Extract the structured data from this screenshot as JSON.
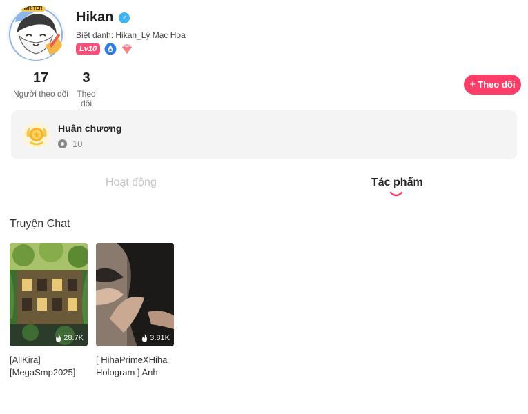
{
  "profile": {
    "avatar_badge": "WRITER",
    "username": "Hikan",
    "gender_icon": "male-icon",
    "nickname": "Biệt danh: Hikan_Lý Mạc Hoa",
    "level": "Lv10",
    "badges": [
      "blue-drop-badge-icon",
      "pink-gem-badge-icon"
    ]
  },
  "stats": {
    "followers_count": "17",
    "followers_label": "Người theo dõi",
    "following_count": "3",
    "following_label": "Theo dõi"
  },
  "follow_button": {
    "icon": "+",
    "label": "Theo dõi"
  },
  "medals": {
    "title": "Huân chương",
    "count": "10"
  },
  "tabs": [
    {
      "label": "Hoạt động",
      "active": false
    },
    {
      "label": "Tác phẩm",
      "active": true
    }
  ],
  "section": {
    "title": "Truyện Chat"
  },
  "stories": [
    {
      "title": "[AllKira] [MegaSmp2025]",
      "views": "28.7K"
    },
    {
      "title": "[ HihaPrimeXHiha Hologram ] Anh",
      "views": "3.81K"
    }
  ],
  "colors": {
    "accent": "#ff3d69",
    "level_badge": "#ff4d7a",
    "gender": "#3fb4f3",
    "card_bg": "#f4f4f4"
  }
}
